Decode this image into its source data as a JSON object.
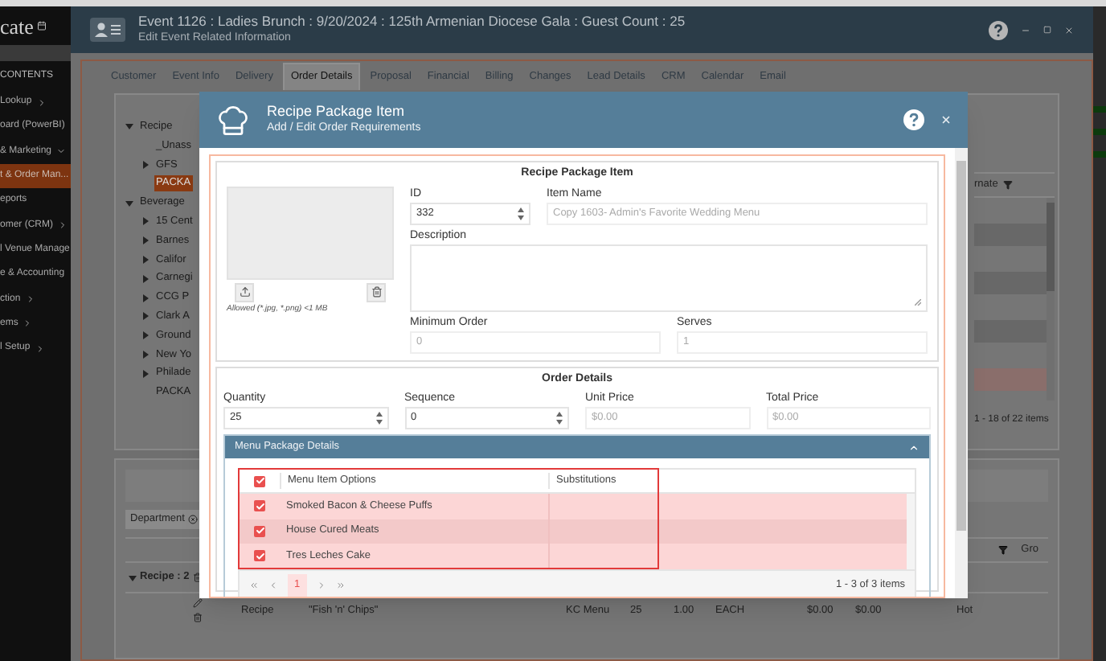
{
  "sidebar": {
    "logo": "cate",
    "heading": "CONTENTS",
    "items": [
      {
        "label": "Lookup",
        "kind": "submenu",
        "expanded": false,
        "selected": false
      },
      {
        "label": "oard (PowerBI)",
        "kind": "link",
        "selected": false
      },
      {
        "label": "& Marketing",
        "kind": "submenu",
        "expanded": true,
        "selected": false
      },
      {
        "label": "t & Order Man...",
        "kind": "link",
        "selected": true
      },
      {
        "label": "eports",
        "kind": "link",
        "selected": false
      },
      {
        "label": "omer (CRM)",
        "kind": "submenu",
        "expanded": false,
        "selected": false
      },
      {
        "label": "l Venue Manage",
        "kind": "link",
        "selected": false
      },
      {
        "label": "e & Accounting",
        "kind": "link",
        "selected": false
      },
      {
        "label": "ction",
        "kind": "submenu",
        "expanded": false,
        "selected": false
      },
      {
        "label": "ems",
        "kind": "submenu",
        "expanded": false,
        "selected": false
      },
      {
        "label": "l Setup",
        "kind": "submenu",
        "expanded": false,
        "selected": false
      }
    ]
  },
  "event_window": {
    "title": "Event 1126 : Ladies Brunch : 9/20/2024 : 125th Armenian Diocese Gala : Guest Count : 25",
    "subtitle": "Edit Event Related Information",
    "tabs": [
      {
        "label": "Customer",
        "selected": false
      },
      {
        "label": "Event Info",
        "selected": false
      },
      {
        "label": "Delivery",
        "selected": false
      },
      {
        "label": "Order Details",
        "selected": true
      },
      {
        "label": "Proposal",
        "selected": false
      },
      {
        "label": "Financial",
        "selected": false
      },
      {
        "label": "Billing",
        "selected": false
      },
      {
        "label": "Changes",
        "selected": false
      },
      {
        "label": "Lead Details",
        "selected": false
      },
      {
        "label": "CRM",
        "selected": false
      },
      {
        "label": "Calendar",
        "selected": false
      },
      {
        "label": "Email",
        "selected": false
      }
    ]
  },
  "tree": [
    {
      "label": "Recipe",
      "kind": "folder",
      "expanded": true,
      "selected": false,
      "children": [
        {
          "label": "_Unass",
          "kind": "leaf",
          "selected": false
        },
        {
          "label": "GFS",
          "kind": "folder",
          "expanded": false,
          "selected": false
        },
        {
          "label": "PACKA",
          "kind": "leaf",
          "selected": true
        }
      ]
    },
    {
      "label": "Beverage",
      "kind": "folder",
      "expanded": true,
      "selected": false,
      "children": [
        {
          "label": "15 Cent",
          "kind": "folder",
          "expanded": false,
          "selected": false
        },
        {
          "label": "Barnes",
          "kind": "folder",
          "expanded": false,
          "selected": false
        },
        {
          "label": "Califor",
          "kind": "folder",
          "expanded": false,
          "selected": false
        },
        {
          "label": "Carnegi",
          "kind": "folder",
          "expanded": false,
          "selected": false
        },
        {
          "label": "CCG P",
          "kind": "folder",
          "expanded": false,
          "selected": false
        },
        {
          "label": "Clark A",
          "kind": "folder",
          "expanded": false,
          "selected": false
        },
        {
          "label": "Ground",
          "kind": "folder",
          "expanded": false,
          "selected": false
        },
        {
          "label": "New Yo",
          "kind": "folder",
          "expanded": false,
          "selected": false
        },
        {
          "label": "Philade",
          "kind": "folder",
          "expanded": false,
          "selected": false
        },
        {
          "label": "PACKA",
          "kind": "leaf",
          "selected": false
        }
      ]
    }
  ],
  "side_grid": {
    "column_1": "rnate",
    "rows": [
      {
        "selected": false
      },
      {
        "selected": false
      },
      {
        "selected": false
      },
      {
        "selected": true
      }
    ],
    "pager": "1 - 18 of 22 items"
  },
  "lower_grid": {
    "filter_chip": "Department",
    "column_label": "Gro",
    "group": {
      "label": "Recipe : 2",
      "expanded": true
    },
    "rows": [
      {
        "cells": [
          "Recipe",
          "\"Fish 'n' Chips\"",
          "KC Menu",
          "25",
          "1.00",
          "EACH",
          "$0.00",
          "$0.00",
          "Hot"
        ]
      }
    ]
  },
  "modal": {
    "title": "Recipe Package Item",
    "subtitle": "Add / Edit Order Requirements",
    "item_section": {
      "heading": "Recipe Package Item",
      "image_hint": "Allowed (*.jpg, *.png) <1 MB",
      "id": {
        "label": "ID",
        "value": "332",
        "kind": "number",
        "disabled": false
      },
      "name": {
        "label": "Item Name",
        "value": "Copy 1603- Admin's Favorite Wedding Menu",
        "kind": "text",
        "disabled": true
      },
      "description": {
        "label": "Description",
        "kind": "textarea"
      },
      "bottom_fields": [
        {
          "label": "Minimum Order",
          "value": "0",
          "kind": "text",
          "disabled": true
        },
        {
          "label": "Serves",
          "value": "1",
          "kind": "text",
          "disabled": true
        }
      ]
    },
    "order_section": {
      "heading": "Order Details",
      "fields": [
        {
          "label": "Quantity",
          "value": "25",
          "kind": "number",
          "disabled": false
        },
        {
          "label": "Sequence",
          "value": "0",
          "kind": "number",
          "disabled": false
        },
        {
          "label": "Unit Price",
          "value": "$0.00",
          "kind": "text",
          "disabled": true
        },
        {
          "label": "Total Price",
          "value": "$0.00",
          "kind": "text",
          "disabled": true
        }
      ],
      "menu_panel": {
        "title": "Menu Package Details",
        "expanded": true,
        "highlighted": true,
        "all_checked": true,
        "columns": [
          "Menu Item Options",
          "Substitutions"
        ],
        "rows": [
          {
            "option": "Smoked Bacon & Cheese Puffs",
            "checked": true
          },
          {
            "option": "House Cured Meats",
            "checked": true
          },
          {
            "option": "Tres Leches Cake",
            "checked": true
          }
        ],
        "pages": [
          {
            "label": "1",
            "selected": true
          }
        ],
        "summary": "1 - 3 of 3 items"
      }
    }
  }
}
